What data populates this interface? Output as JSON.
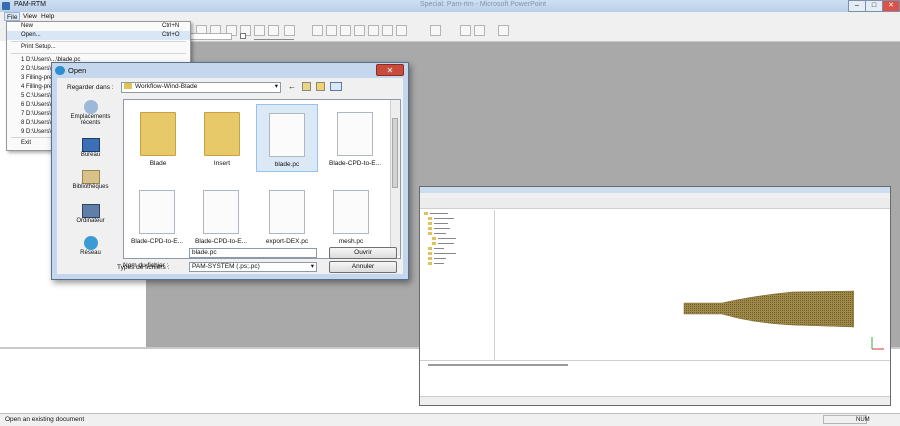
{
  "window": {
    "title": "PAM-RTM",
    "faded_title": "Special: Pam-rtm - Microsoft PowerPoint",
    "controls": [
      "–",
      "□",
      "✕"
    ]
  },
  "menubar": {
    "items": [
      "File",
      "View",
      "Help"
    ]
  },
  "file_menu": {
    "items": [
      {
        "label": "New",
        "shortcut": "Ctrl+N"
      },
      {
        "label": "Open...",
        "shortcut": "Ctrl+O"
      },
      {
        "label": "Print Setup...",
        "shortcut": ""
      },
      {
        "label": "1 D:\\Users\\...\\blade.pc",
        "shortcut": ""
      },
      {
        "label": "2 D:\\Users\\...",
        "shortcut": ""
      },
      {
        "label": "3 Filling-pre...",
        "shortcut": ""
      },
      {
        "label": "4 Filling-pre...",
        "shortcut": ""
      },
      {
        "label": "5 C:\\Users\\...",
        "shortcut": ""
      },
      {
        "label": "6 D:\\Users\\...",
        "shortcut": ""
      },
      {
        "label": "7 D:\\Users\\...",
        "shortcut": ""
      },
      {
        "label": "8 D:\\Users\\...",
        "shortcut": ""
      },
      {
        "label": "9 D:\\Users\\...",
        "shortcut": ""
      },
      {
        "label": "Exit",
        "shortcut": ""
      }
    ]
  },
  "open_dialog": {
    "title": "Open",
    "look_in_label": "Regarder dans :",
    "look_in_value": "Workflow-Wind-Blade",
    "places": [
      "Emplacements récents",
      "Bureau",
      "Bibliothèques",
      "Ordinateur",
      "Réseau"
    ],
    "files": [
      {
        "name": "Blade",
        "kind": "folder"
      },
      {
        "name": "Insert",
        "kind": "folder"
      },
      {
        "name": "blade.pc",
        "kind": "file",
        "selected": true
      },
      {
        "name": "Blade-CPD-to-E...",
        "kind": "file"
      },
      {
        "name": "Blade-CPD-to-E...",
        "kind": "file"
      },
      {
        "name": "Blade-CPD-to-E...",
        "kind": "file"
      },
      {
        "name": "export-DEX.pc",
        "kind": "file"
      },
      {
        "name": "mesh.pc",
        "kind": "file"
      }
    ],
    "filename_label": "Nom du fichier :",
    "filename_value": "blade.pc",
    "filetype_label": "Types de fichiers :",
    "filetype_value": "PAM-SYSTEM (.ps;.pc)",
    "open_button": "Ouvrir",
    "cancel_button": "Annuler"
  },
  "status": {
    "message": "Open an existing document",
    "indicator": "NUM"
  },
  "colors": {
    "titlebar": "#c4d8ef",
    "blade": "#a08a4a",
    "close": "#c94b3c"
  }
}
